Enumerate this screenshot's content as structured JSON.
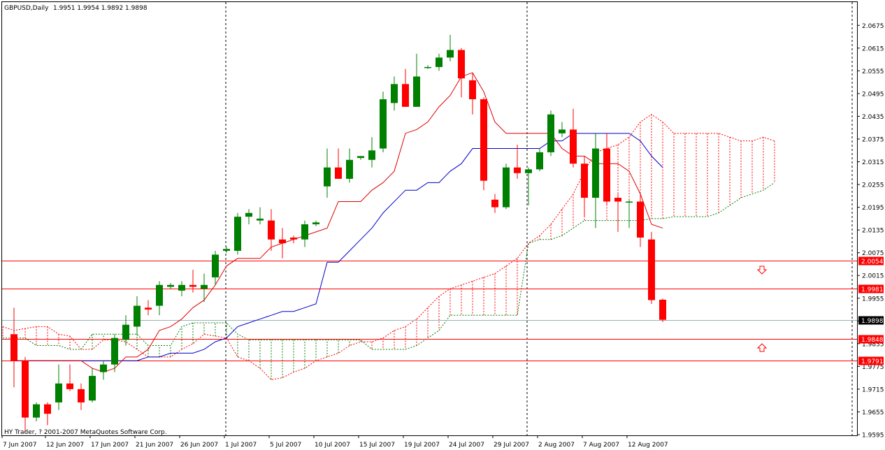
{
  "chart_data": {
    "type": "candlestick",
    "symbol_title": "GBPUSD,Daily",
    "ohlc_header": "1.9951 1.9954 1.9892 1.9898",
    "copyright": "HY Trader, ? 2001-2007 MetaQuotes Software Corp.",
    "y_ticks": [
      "2.0675",
      "2.0615",
      "2.0555",
      "2.0495",
      "2.0435",
      "2.0375",
      "2.0315",
      "2.0255",
      "2.0195",
      "2.0135",
      "2.0075",
      "2.0015",
      "1.9955",
      "1.9895",
      "1.9835",
      "1.9775",
      "1.9715",
      "1.9655",
      "1.9595"
    ],
    "x_ticks": [
      "7 Jun 2007",
      "12 Jun 2007",
      "17 Jun 2007",
      "21 Jun 2007",
      "26 Jun 2007",
      "1 Jul 2007",
      "5 Jul 2007",
      "10 Jul 2007",
      "15 Jul 2007",
      "19 Jul 2007",
      "24 Jul 2007",
      "29 Jul 2007",
      "2 Aug 2007",
      "7 Aug 2007",
      "12 Aug 2007"
    ],
    "ylim": [
      1.9595,
      2.0705
    ],
    "horizontal_levels": [
      {
        "label": "2.0054",
        "value": 2.0054,
        "color": "#ff0000"
      },
      {
        "label": "1.9981",
        "value": 1.9981,
        "color": "#ff0000"
      },
      {
        "label": "1.9848",
        "value": 1.9848,
        "color": "#ff0000"
      },
      {
        "label": "1.9791",
        "value": 1.9791,
        "color": "#ff0000"
      }
    ],
    "current_price": {
      "label": "1.9898",
      "value": 1.9898
    },
    "candles": [
      {
        "o": 1.986,
        "h": 1.993,
        "l": 1.972,
        "c": 1.979
      },
      {
        "o": 1.979,
        "h": 1.98,
        "l": 1.96,
        "c": 1.964
      },
      {
        "o": 1.964,
        "h": 1.968,
        "l": 1.963,
        "c": 1.9675
      },
      {
        "o": 1.9675,
        "h": 1.968,
        "l": 1.962,
        "c": 1.965
      },
      {
        "o": 1.968,
        "h": 1.978,
        "l": 1.966,
        "c": 1.973
      },
      {
        "o": 1.973,
        "h": 1.978,
        "l": 1.971,
        "c": 1.9715
      },
      {
        "o": 1.9715,
        "h": 1.973,
        "l": 1.966,
        "c": 1.968
      },
      {
        "o": 1.9685,
        "h": 1.977,
        "l": 1.968,
        "c": 1.975
      },
      {
        "o": 1.976,
        "h": 1.979,
        "l": 1.974,
        "c": 1.978
      },
      {
        "o": 1.978,
        "h": 1.986,
        "l": 1.976,
        "c": 1.985
      },
      {
        "o": 1.9845,
        "h": 1.991,
        "l": 1.983,
        "c": 1.9885
      },
      {
        "o": 1.988,
        "h": 1.996,
        "l": 1.986,
        "c": 1.9935
      },
      {
        "o": 1.993,
        "h": 1.995,
        "l": 1.991,
        "c": 1.9925
      },
      {
        "o": 1.9935,
        "h": 2.0,
        "l": 1.991,
        "c": 1.999
      },
      {
        "o": 1.9985,
        "h": 1.9995,
        "l": 1.998,
        "c": 1.999
      },
      {
        "o": 1.9975,
        "h": 2.0,
        "l": 1.996,
        "c": 1.999
      },
      {
        "o": 1.999,
        "h": 2.003,
        "l": 1.997,
        "c": 1.9985
      },
      {
        "o": 1.998,
        "h": 2.002,
        "l": 1.9945,
        "c": 1.999
      },
      {
        "o": 2.001,
        "h": 2.008,
        "l": 1.999,
        "c": 2.007
      },
      {
        "o": 2.008,
        "h": 2.009,
        "l": 2.0075,
        "c": 2.0085
      },
      {
        "o": 2.008,
        "h": 2.018,
        "l": 2.007,
        "c": 2.017
      },
      {
        "o": 2.017,
        "h": 2.019,
        "l": 2.015,
        "c": 2.018
      },
      {
        "o": 2.016,
        "h": 2.0195,
        "l": 2.015,
        "c": 2.0165
      },
      {
        "o": 2.016,
        "h": 2.019,
        "l": 2.008,
        "c": 2.011
      },
      {
        "o": 2.011,
        "h": 2.014,
        "l": 2.006,
        "c": 2.01
      },
      {
        "o": 2.0115,
        "h": 2.012,
        "l": 2.01,
        "c": 2.011
      },
      {
        "o": 2.011,
        "h": 2.016,
        "l": 2.009,
        "c": 2.015
      },
      {
        "o": 2.015,
        "h": 2.016,
        "l": 2.0145,
        "c": 2.0155
      },
      {
        "o": 2.025,
        "h": 2.035,
        "l": 2.022,
        "c": 2.03
      },
      {
        "o": 2.03,
        "h": 2.035,
        "l": 2.027,
        "c": 2.027
      },
      {
        "o": 2.027,
        "h": 2.035,
        "l": 2.026,
        "c": 2.032
      },
      {
        "o": 2.0325,
        "h": 2.033,
        "l": 2.032,
        "c": 2.033
      },
      {
        "o": 2.032,
        "h": 2.038,
        "l": 2.03,
        "c": 2.0345
      },
      {
        "o": 2.035,
        "h": 2.05,
        "l": 2.034,
        "c": 2.048
      },
      {
        "o": 2.047,
        "h": 2.054,
        "l": 2.045,
        "c": 2.052
      },
      {
        "o": 2.052,
        "h": 2.056,
        "l": 2.046,
        "c": 2.046
      },
      {
        "o": 2.046,
        "h": 2.06,
        "l": 2.046,
        "c": 2.054
      },
      {
        "o": 2.0565,
        "h": 2.057,
        "l": 2.056,
        "c": 2.0565
      },
      {
        "o": 2.0565,
        "h": 2.06,
        "l": 2.0555,
        "c": 2.059
      },
      {
        "o": 2.059,
        "h": 2.065,
        "l": 2.058,
        "c": 2.061
      },
      {
        "o": 2.061,
        "h": 2.0615,
        "l": 2.0485,
        "c": 2.0535
      },
      {
        "o": 2.053,
        "h": 2.055,
        "l": 2.044,
        "c": 2.048
      },
      {
        "o": 2.048,
        "h": 2.0485,
        "l": 2.024,
        "c": 2.0265
      },
      {
        "o": 2.0215,
        "h": 2.023,
        "l": 2.018,
        "c": 2.0195
      },
      {
        "o": 2.0195,
        "h": 2.031,
        "l": 2.019,
        "c": 2.03
      },
      {
        "o": 2.03,
        "h": 2.036,
        "l": 2.027,
        "c": 2.0285
      },
      {
        "o": 2.0285,
        "h": 2.03,
        "l": 2.02,
        "c": 2.0295
      },
      {
        "o": 2.0295,
        "h": 2.035,
        "l": 2.029,
        "c": 2.034
      },
      {
        "o": 2.034,
        "h": 2.045,
        "l": 2.033,
        "c": 2.044
      },
      {
        "o": 2.039,
        "h": 2.042,
        "l": 2.038,
        "c": 2.04
      },
      {
        "o": 2.04,
        "h": 2.0455,
        "l": 2.03,
        "c": 2.031
      },
      {
        "o": 2.031,
        "h": 2.033,
        "l": 2.017,
        "c": 2.022
      },
      {
        "o": 2.022,
        "h": 2.039,
        "l": 2.014,
        "c": 2.035
      },
      {
        "o": 2.035,
        "h": 2.039,
        "l": 2.02,
        "c": 2.021
      },
      {
        "o": 2.022,
        "h": 2.023,
        "l": 2.013,
        "c": 2.021
      },
      {
        "o": 2.021,
        "h": 2.0215,
        "l": 2.014,
        "c": 2.021
      },
      {
        "o": 2.021,
        "h": 2.023,
        "l": 2.009,
        "c": 2.0115
      },
      {
        "o": 2.011,
        "h": 2.013,
        "l": 1.994,
        "c": 1.995
      },
      {
        "o": 1.9951,
        "h": 1.9954,
        "l": 1.9892,
        "c": 1.9898
      }
    ],
    "tenkan_sen": [
      1.979,
      1.979,
      1.979,
      1.979,
      1.979,
      1.979,
      1.979,
      1.977,
      1.976,
      1.977,
      1.98,
      1.98,
      1.982,
      1.987,
      1.988,
      1.99,
      1.993,
      1.995,
      1.999,
      2.004,
      2.006,
      2.006,
      2.006,
      2.009,
      2.01,
      2.011,
      2.012,
      2.013,
      2.014,
      2.021,
      2.021,
      2.021,
      2.024,
      2.026,
      2.029,
      2.039,
      2.04,
      2.042,
      2.046,
      2.049,
      2.054,
      2.055,
      2.05,
      2.042,
      2.039,
      2.039,
      2.039,
      2.039,
      2.039,
      2.035,
      2.033,
      2.033,
      2.031,
      2.031,
      2.031,
      2.029,
      2.023,
      2.015,
      2.014
    ],
    "kijun_sen": [
      1.979,
      1.979,
      1.979,
      1.979,
      1.979,
      1.979,
      1.979,
      1.979,
      1.979,
      1.979,
      1.979,
      1.979,
      1.98,
      1.98,
      1.981,
      1.981,
      1.981,
      1.982,
      1.984,
      1.985,
      1.988,
      1.989,
      1.99,
      1.991,
      1.992,
      1.992,
      1.993,
      1.994,
      2.005,
      2.005,
      2.008,
      2.011,
      2.014,
      2.018,
      2.021,
      2.024,
      2.024,
      2.026,
      2.026,
      2.029,
      2.031,
      2.035,
      2.035,
      2.035,
      2.035,
      2.035,
      2.035,
      2.035,
      2.037,
      2.037,
      2.039,
      2.039,
      2.039,
      2.039,
      2.039,
      2.039,
      2.037,
      2.033,
      2.03
    ],
    "span_a": [
      1.988,
      1.987,
      1.9875,
      1.988,
      1.988,
      1.986,
      1.9855,
      1.982,
      1.982,
      1.9845,
      1.9845,
      1.984,
      1.982,
      1.98,
      1.98,
      1.98,
      1.982,
      1.9835,
      1.986,
      1.9855,
      1.985,
      1.98,
      1.979,
      1.977,
      1.974,
      1.9745,
      1.976,
      1.977,
      1.979,
      1.98,
      1.981,
      1.983,
      1.984,
      1.984,
      1.985,
      1.987,
      1.988,
      1.99,
      1.993,
      1.996,
      1.998,
      1.999,
      2.0,
      2.001,
      2.002,
      2.004,
      2.006,
      2.01,
      2.012,
      2.015,
      2.019,
      2.023,
      2.029,
      2.034,
      2.035,
      2.036,
      2.038,
      2.042,
      2.044,
      2.042,
      2.039,
      2.039,
      2.039,
      2.039,
      2.039,
      2.038,
      2.037,
      2.037,
      2.038,
      2.037,
      2.036,
      2.0355
    ],
    "span_b": [
      1.985,
      1.985,
      1.985,
      1.983,
      1.983,
      1.983,
      1.982,
      1.982,
      1.986,
      1.986,
      1.986,
      1.986,
      1.986,
      1.983,
      1.983,
      1.983,
      1.988,
      1.989,
      1.989,
      1.989,
      1.989,
      1.986,
      1.9845,
      1.9845,
      1.9845,
      1.9845,
      1.9845,
      1.9845,
      1.9845,
      1.9845,
      1.9845,
      1.9845,
      1.9845,
      1.982,
      1.982,
      1.982,
      1.982,
      1.983,
      1.985,
      1.987,
      1.991,
      1.991,
      1.991,
      1.991,
      1.991,
      1.991,
      1.991,
      2.01,
      2.011,
      2.011,
      2.012,
      2.014,
      2.016,
      2.016,
      2.016,
      2.016,
      2.016,
      2.016,
      2.0165,
      2.0165,
      2.017,
      2.017,
      2.017,
      2.017,
      2.018,
      2.02,
      2.022,
      2.023,
      2.024,
      2.026
    ],
    "vertical_separators": [
      1,
      12,
      13
    ]
  }
}
